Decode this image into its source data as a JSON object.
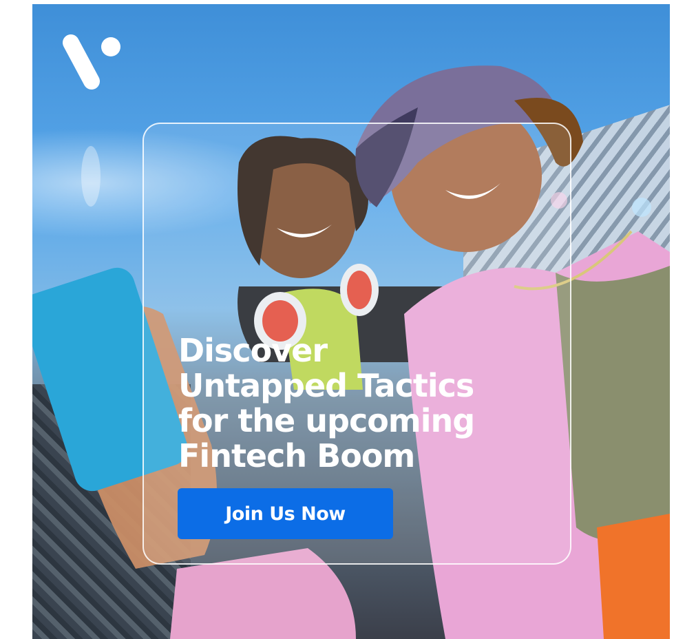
{
  "ad": {
    "logo_icon": "brand-v-mark-icon",
    "headline_lines": [
      "Discover",
      "Untapped Tactics",
      "for the upcoming",
      "Fintech Boom"
    ],
    "cta_label": "Join Us Now"
  },
  "colors": {
    "cta_background": "#0c6de6",
    "headline_text": "#ffffff",
    "sky": "#4a9be0",
    "jacket_pink": "#e9a6d6"
  }
}
